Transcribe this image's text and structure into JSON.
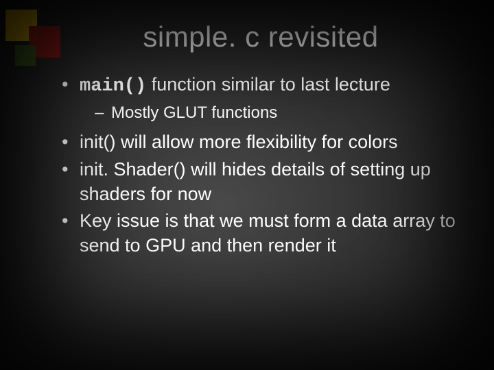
{
  "slide": {
    "title": "simple. c revisited",
    "bullet1_code": "main()",
    "bullet1_rest": " function similar to last lecture",
    "bullet1_sub1": "Mostly GLUT functions",
    "bullet2": "init() will allow more flexibility for colors",
    "bullet3": "init. Shader() will hides details of setting up shaders for now",
    "bullet4": "Key issue is that we must form a data array to send to GPU and then render it"
  }
}
